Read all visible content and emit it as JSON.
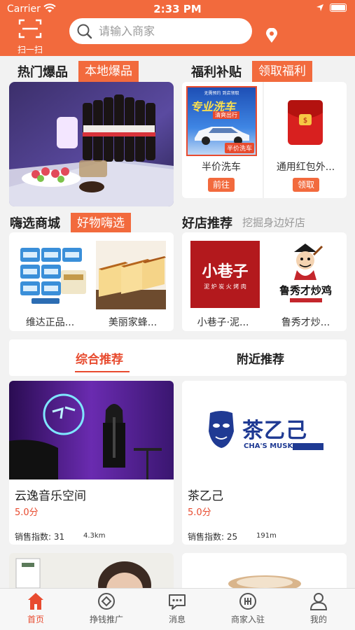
{
  "status": {
    "carrier": "Carrier",
    "time": "2:33 PM"
  },
  "header": {
    "scan_label": "扫一扫",
    "search_placeholder": "请输入商家"
  },
  "hot": {
    "title": "热门爆品",
    "tag": "本地爆品"
  },
  "welfare": {
    "title": "福利补贴",
    "tag": "领取福利",
    "items": [
      {
        "caption": "半价洗车",
        "button": "前往",
        "poster_big": "专业洗车",
        "poster_small": "清爽出行",
        "poster_badge": "半价洗车",
        "poster_top": "无需预约 到店领取"
      },
      {
        "caption": "通用红包外...",
        "button": "领取"
      }
    ]
  },
  "mall": {
    "title": "嗨选商城",
    "tag": "好物嗨选",
    "items": [
      {
        "caption": "维达正品..."
      },
      {
        "caption": "美丽家蜂..."
      }
    ]
  },
  "shops": {
    "title": "好店推荐",
    "subtitle": "挖掘身边好店",
    "items": [
      {
        "caption": "小巷子·泥...",
        "logo_main": "小巷子",
        "logo_sub": "泥 炉 炭 火 烤 肉"
      },
      {
        "caption": "鲁秀才炒...",
        "logo_main": "鲁秀才炒鸡"
      }
    ]
  },
  "tabs": {
    "items": [
      "综合推荐",
      "附近推荐"
    ],
    "active": 0
  },
  "stores": [
    {
      "name": "云逸音乐空间",
      "score": "5.0分",
      "sales": "销售指数: 31",
      "distance": "4.3km"
    },
    {
      "name": "茶乙己",
      "score": "5.0分",
      "sales": "销售指数: 25",
      "distance": "191m",
      "logo_main": "茶乙己",
      "logo_sub": "CHA'S MUSK"
    }
  ],
  "tabbar": {
    "items": [
      {
        "label": "首页",
        "icon": "home-icon"
      },
      {
        "label": "挣钱推广",
        "icon": "promote-icon"
      },
      {
        "label": "消息",
        "icon": "message-icon"
      },
      {
        "label": "商家入驻",
        "icon": "merchant-icon"
      },
      {
        "label": "我的",
        "icon": "profile-icon"
      }
    ],
    "active": 0
  },
  "colors": {
    "accent": "#f26a3d",
    "active_red": "#e84b2f"
  }
}
